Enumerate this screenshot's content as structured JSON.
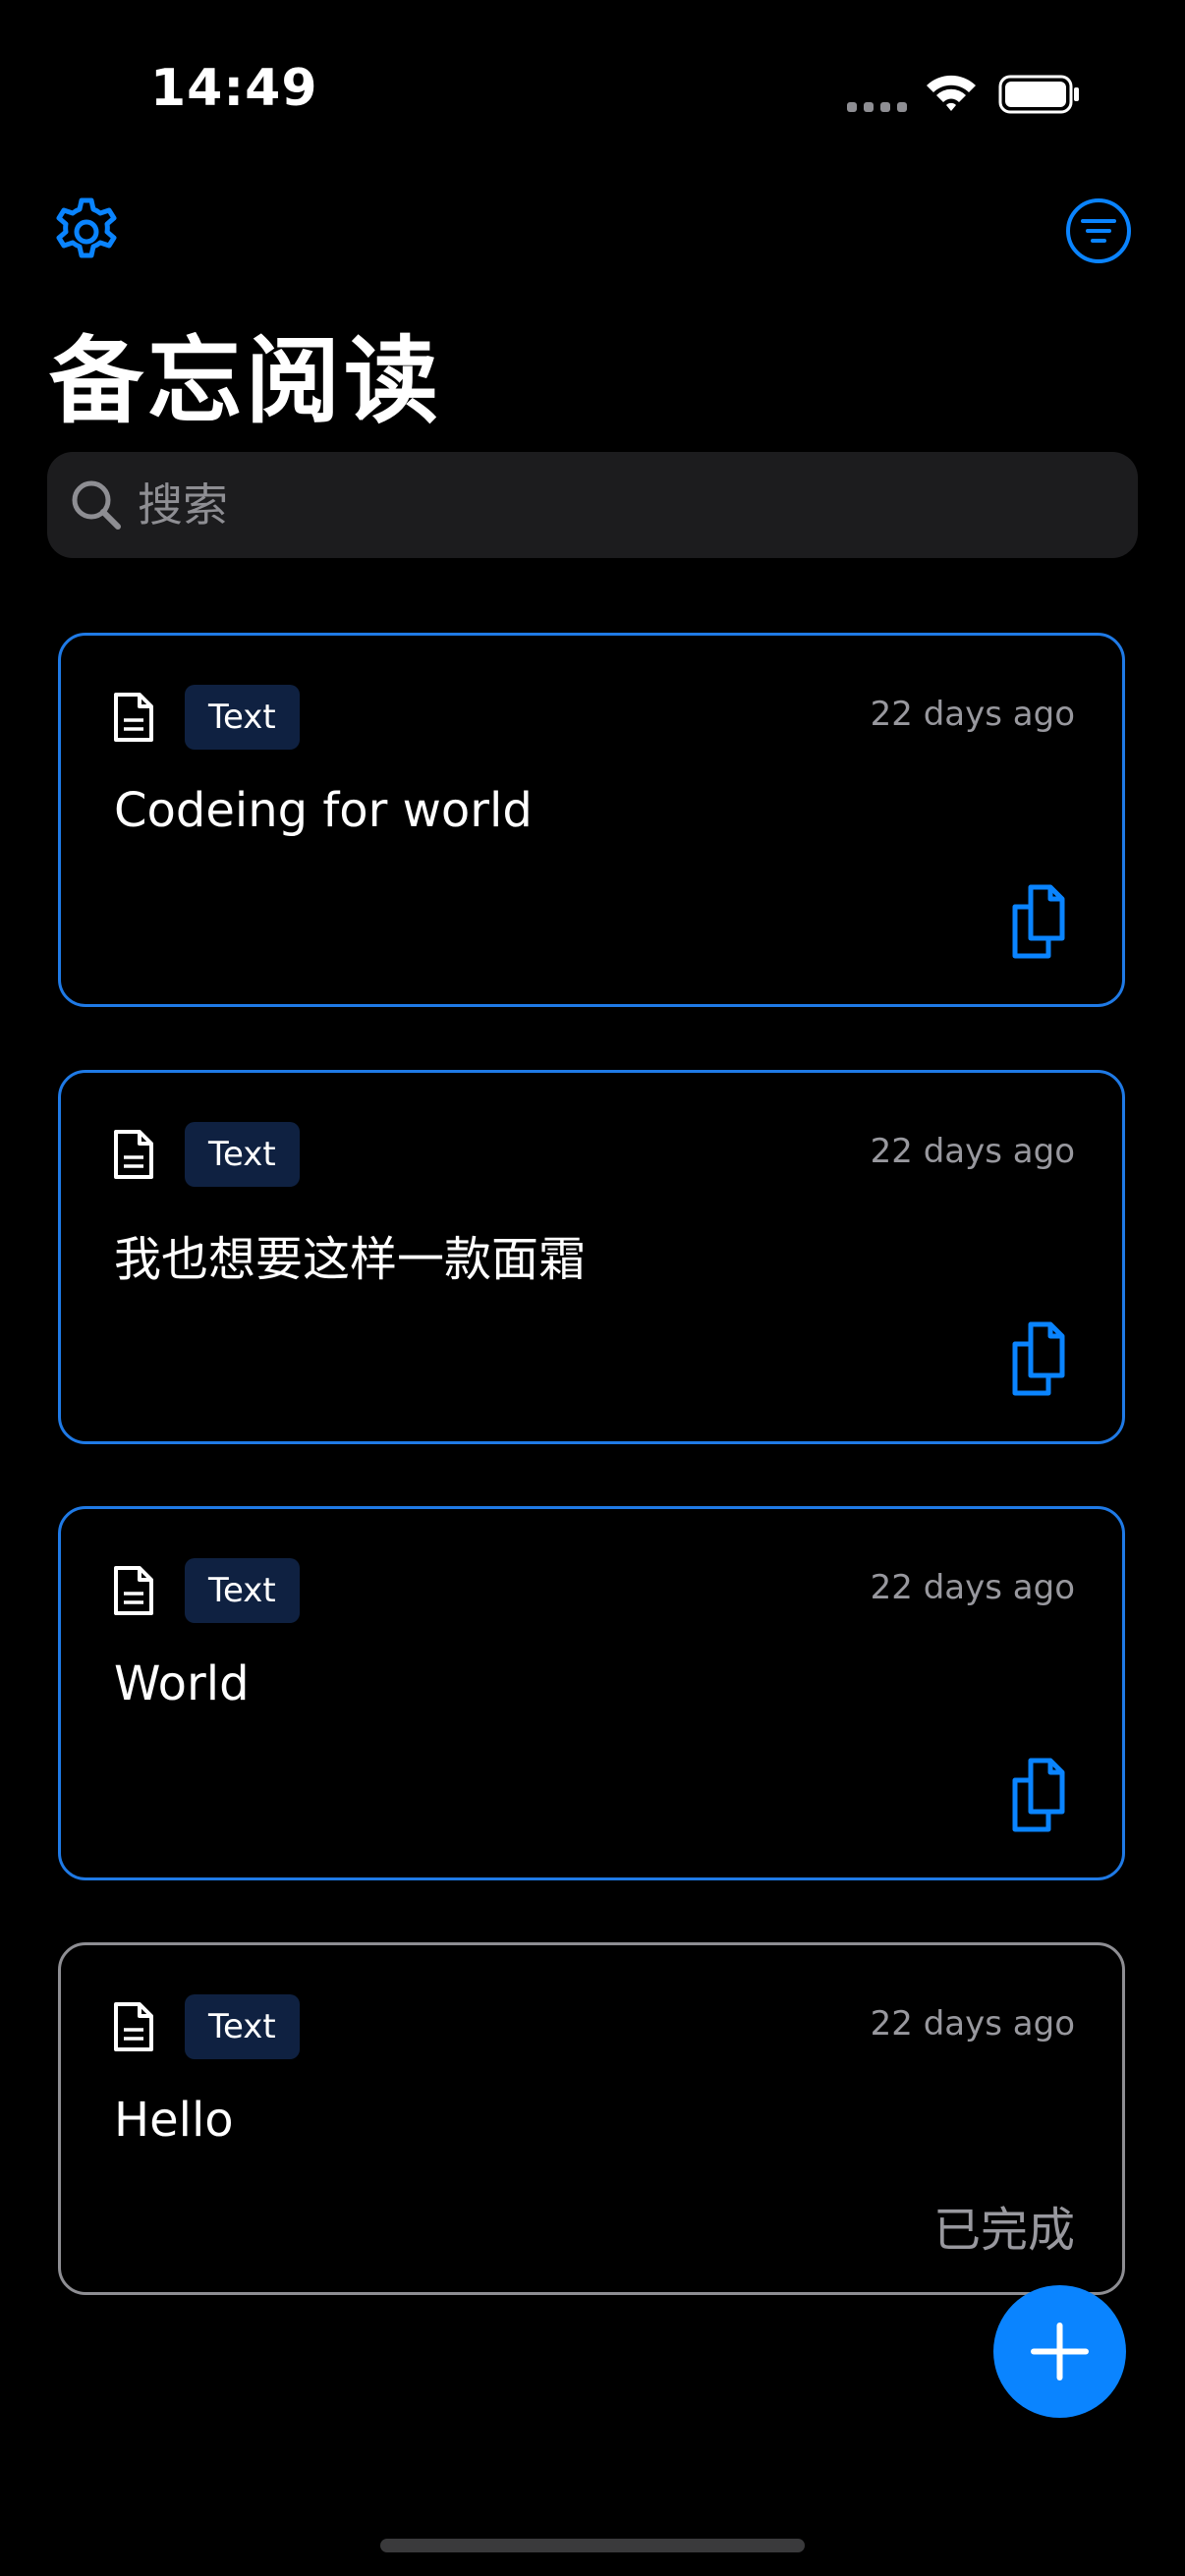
{
  "status_bar": {
    "time": "14:49"
  },
  "header": {
    "title": "备忘阅读",
    "settings_icon": "gear-icon",
    "filter_icon": "filter-icon"
  },
  "search": {
    "placeholder": "搜索",
    "value": ""
  },
  "colors": {
    "accent": "#0a84ff",
    "card_border_active": "#1f7ae6",
    "card_border_done": "#8e8e93",
    "tag_bg": "#0f2141",
    "search_bg": "#1c1c1e"
  },
  "cards": [
    {
      "tag": "Text",
      "time": "22 days ago",
      "text": "Codeing for world",
      "action_icon": "copy-icon"
    },
    {
      "tag": "Text",
      "time": "22 days ago",
      "text": "我也想要这样一款面霜",
      "action_icon": "copy-icon"
    },
    {
      "tag": "Text",
      "time": "22 days ago",
      "text": "World",
      "action_icon": "copy-icon"
    },
    {
      "tag": "Text",
      "time": "22 days ago",
      "text": "Hello",
      "status": "已完成"
    }
  ],
  "fab": {
    "icon": "plus-icon"
  }
}
